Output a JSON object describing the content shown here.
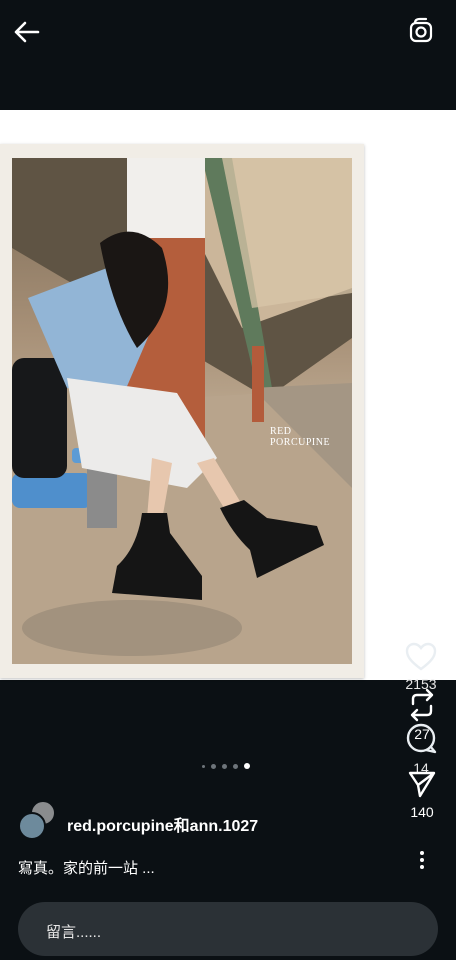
{
  "header": {
    "back_icon": "arrow-left-icon",
    "camera_icon": "camera-icon"
  },
  "post": {
    "photo_watermark": "RED PORCUPINE",
    "carousel": {
      "count": 4,
      "active_index": 3
    },
    "likes": "2153",
    "comments": "14",
    "reposts": "27",
    "shares": "140",
    "author": "red.porcupine和ann.1027",
    "caption": "寫真。家的前一站 ..."
  },
  "comment_box": {
    "placeholder": "留言......"
  },
  "colors": {
    "background": "#0b1014",
    "input": "#2b3136"
  }
}
